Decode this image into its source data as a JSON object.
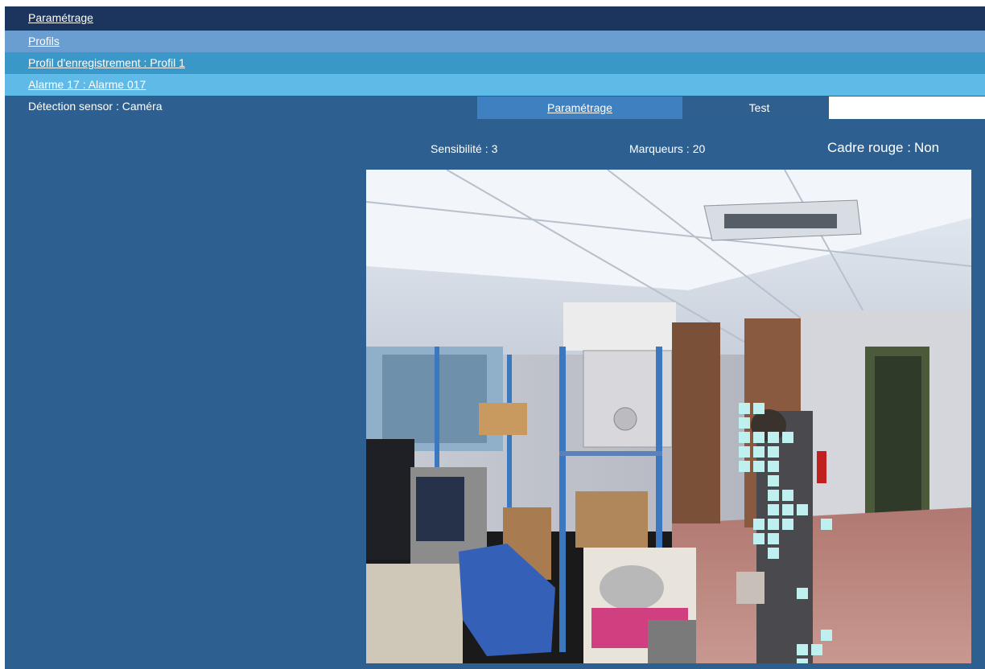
{
  "breadcrumbs": {
    "parametrage": "Paramétrage",
    "profils": "Profils",
    "profil": "Profil d'enregistrement : Profil 1",
    "alarme": "Alarme 17 : Alarme 017"
  },
  "detection_label": "Détection sensor : Caméra",
  "tabs": {
    "parametrage": "Paramétrage",
    "test": "Test"
  },
  "settings": {
    "sensibilite_label": "Sensibilité :",
    "sensibilite_value": "3",
    "marqueurs_label": "Marqueurs :",
    "marqueurs_value": "20",
    "cadre_label": "Cadre rouge :",
    "cadre_value": "Non"
  },
  "colors": {
    "header_dark": "#1c355e",
    "background": "#2d6090",
    "marker": "#bff0f0"
  },
  "icons": [
    "camera-feed",
    "motion-marker"
  ]
}
